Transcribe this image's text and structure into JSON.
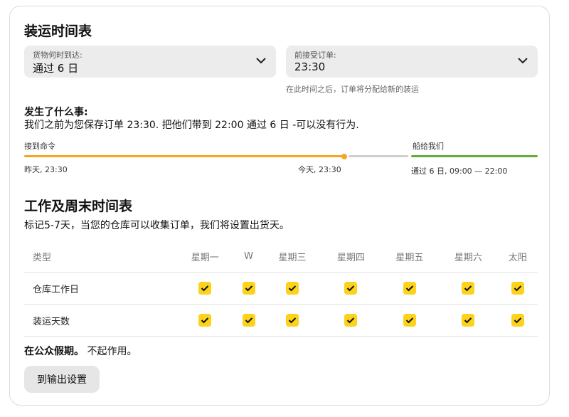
{
  "title": "装运时间表",
  "arrival_select": {
    "label": "货物何时到达:",
    "value": "通过 6 日"
  },
  "accept_select": {
    "label": "前接受订单:",
    "value": "23:30"
  },
  "accept_hint": "在此时间之后，订单将分配给新的装运",
  "what_happened": {
    "title": "发生了什么事:",
    "text": "我们之前为您保存订单 23:30. 把他们带到 22:00 通过 6 日 -可以没有行为."
  },
  "timeline": {
    "left_label": "接到命令",
    "right_label": "船给我们",
    "start_time": "昨天, 23:30",
    "now_time": "今天, 23:30",
    "ship_time": "通过 6 日, 09:00 — 22:00",
    "colors": {
      "orange": "#f5a623",
      "gray": "#cfcfcf",
      "green": "#5fae3a"
    }
  },
  "schedule": {
    "title": "工作及周末时间表",
    "description": "标记5-7天，当您的仓库可以收集订单，我们将设置出货天。",
    "type_header": "类型",
    "days": [
      "星期一",
      "W",
      "星期三",
      "星期四",
      "星期五",
      "星期六",
      "太阳"
    ],
    "rows": [
      {
        "label": "仓库工作日",
        "checked": [
          true,
          true,
          true,
          true,
          true,
          true,
          true
        ]
      },
      {
        "label": "装运天数",
        "checked": [
          true,
          true,
          true,
          true,
          true,
          true,
          true
        ]
      }
    ]
  },
  "holiday": {
    "bold": "在公众假期。",
    "text": "不起作用。"
  },
  "output_button": "到输出设置",
  "accent_color": "#fcd21b"
}
